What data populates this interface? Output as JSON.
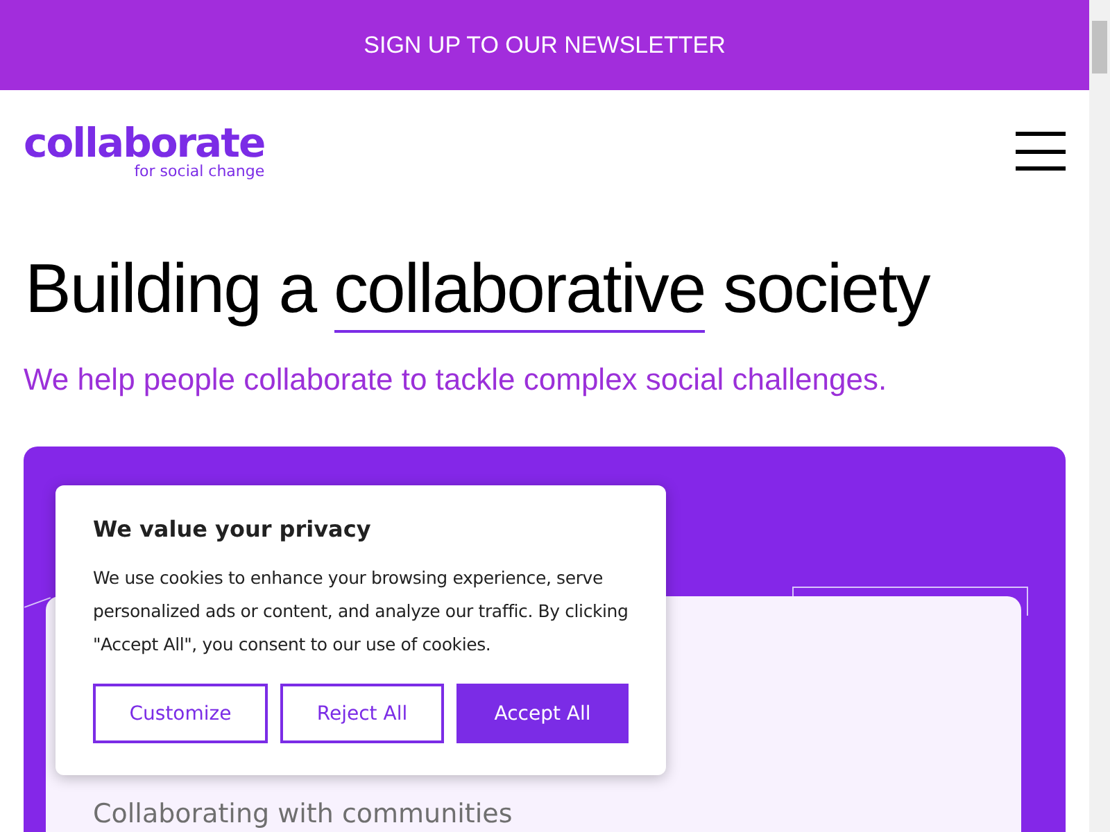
{
  "banner": {
    "label": "SIGN UP TO OUR NEWSLETTER"
  },
  "logo": {
    "name": "collaborate",
    "tagline": "for social change"
  },
  "hero": {
    "heading_before": "Building a",
    "heading_highlight": "collaborative",
    "heading_after": "society",
    "subtitle": "We help people collaborate to tackle complex social challenges."
  },
  "card": {
    "heading": "Collaborating with communities"
  },
  "cookie_dialog": {
    "title": "We value your privacy",
    "body": "We use cookies to enhance your browsing experience, serve personalized ads or content, and analyze our traffic. By clicking \"Accept All\", you consent to our use of cookies.",
    "buttons": [
      {
        "label": "Customize",
        "kind": "outline"
      },
      {
        "label": "Reject All",
        "kind": "outline"
      },
      {
        "label": "Accept All",
        "kind": "filled"
      }
    ]
  }
}
